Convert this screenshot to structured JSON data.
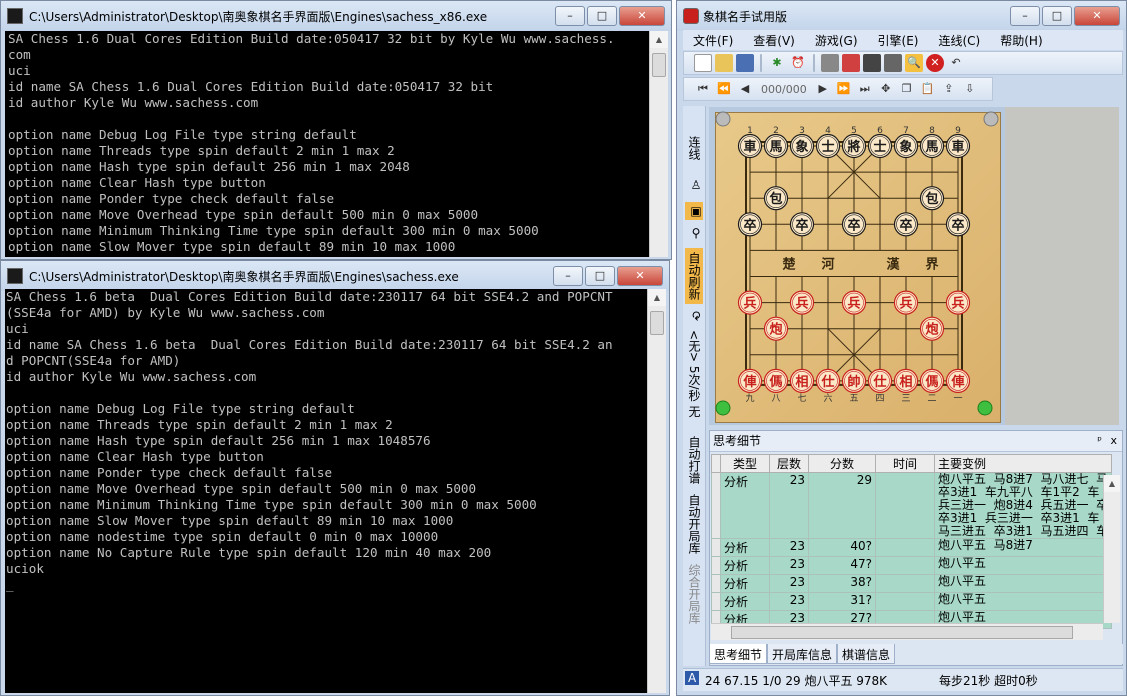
{
  "console1": {
    "title": "C:\\Users\\Administrator\\Desktop\\南奥象棋名手界面版\\Engines\\sachess_x86.exe",
    "lines": [
      "SA Chess 1.6 Dual Cores Edition Build date:050417 32 bit by Kyle Wu www.sachess.",
      "com",
      "uci",
      "id name SA Chess 1.6 Dual Cores Edition Build date:050417 32 bit",
      "id author Kyle Wu www.sachess.com",
      "",
      "option name Debug Log File type string default",
      "option name Threads type spin default 2 min 1 max 2",
      "option name Hash type spin default 256 min 1 max 2048",
      "option name Clear Hash type button",
      "option name Ponder type check default false",
      "option name Move Overhead type spin default 500 min 0 max 5000",
      "option name Minimum Thinking Time type spin default 300 min 0 max 5000",
      "option name Slow Mover type spin default 89 min 10 max 1000"
    ]
  },
  "console2": {
    "title": "C:\\Users\\Administrator\\Desktop\\南奥象棋名手界面版\\Engines\\sachess.exe",
    "lines": [
      "SA Chess 1.6 beta  Dual Cores Edition Build date:230117 64 bit SSE4.2 and POPCNT",
      "(SSE4a for AMD) by Kyle Wu www.sachess.com",
      "uci",
      "id name SA Chess 1.6 beta  Dual Cores Edition Build date:230117 64 bit SSE4.2 an",
      "d POPCNT(SSE4a for AMD)",
      "id author Kyle Wu www.sachess.com",
      "",
      "option name Debug Log File type string default",
      "option name Threads type spin default 2 min 1 max 2",
      "option name Hash type spin default 256 min 1 max 1048576",
      "option name Clear Hash type button",
      "option name Ponder type check default false",
      "option name Move Overhead type spin default 500 min 0 max 5000",
      "option name Minimum Thinking Time type spin default 300 min 0 max 5000",
      "option name Slow Mover type spin default 89 min 10 max 1000",
      "option name nodestime type spin default 0 min 0 max 10000",
      "option name No Capture Rule type spin default 120 min 40 max 200",
      "uciok",
      "_"
    ]
  },
  "app": {
    "title": "象棋名手试用版",
    "menu": [
      "文件(F)",
      "查看(V)",
      "游戏(G)",
      "引擎(E)",
      "连线(C)",
      "帮助(H)"
    ],
    "move_counter": "000/000",
    "sidebar_tabs": [
      "连线",
      "自动刷新",
      "<无> 5次/秒 无",
      "自动打谱",
      "自动开局库",
      "综合开局库"
    ],
    "board": {
      "top_numbers": [
        "1",
        "2",
        "3",
        "4",
        "5",
        "6",
        "7",
        "8",
        "9"
      ],
      "bottom_numbers": [
        "九",
        "八",
        "七",
        "六",
        "五",
        "四",
        "三",
        "二",
        "一"
      ],
      "river": [
        "楚",
        "河",
        "漢",
        "界"
      ],
      "black_pieces": [
        "車",
        "馬",
        "象",
        "士",
        "將",
        "士",
        "象",
        "馬",
        "車",
        "包",
        "包",
        "卒",
        "卒",
        "卒",
        "卒",
        "卒"
      ],
      "red_pieces": [
        "兵",
        "兵",
        "兵",
        "兵",
        "兵",
        "炮",
        "炮",
        "俥",
        "傌",
        "相",
        "仕",
        "帥",
        "仕",
        "相",
        "傌",
        "俥"
      ]
    },
    "panel": {
      "title": "思考细节",
      "pin": "ᵖ",
      "close": "x",
      "headers": [
        "类型",
        "层数",
        "分数",
        "时间",
        "主要变例"
      ],
      "rows": [
        {
          "type": "分析",
          "depth": "23",
          "score": "29",
          "time": "",
          "pv": "炮八平五  马8进7  马八进七  马\n卒3进1  车九平八  车1平2  车\n兵三进一  炮8进4  兵五进一  卒\n卒3进1  兵三进一  卒3进1  车\n马三进五  卒3进1  马五进四  车"
        },
        {
          "type": "分析",
          "depth": "23",
          "score": "40?",
          "time": "",
          "pv": "炮八平五  马8进7"
        },
        {
          "type": "分析",
          "depth": "23",
          "score": "47?",
          "time": "",
          "pv": "炮八平五"
        },
        {
          "type": "分析",
          "depth": "23",
          "score": "38?",
          "time": "",
          "pv": "炮八平五"
        },
        {
          "type": "分析",
          "depth": "23",
          "score": "31?",
          "time": "",
          "pv": "炮八平五"
        },
        {
          "type": "分析",
          "depth": "23",
          "score": "27?",
          "time": "",
          "pv": "炮八平五"
        }
      ]
    },
    "bottom_tabs": [
      "思考细节",
      "开局库信息",
      "棋谱信息"
    ],
    "status": {
      "mode": "A",
      "info": "24  67.15  1/0  29  炮八平五  978K",
      "time": "每步21秒  超时0秒"
    }
  },
  "colors": {
    "console_bg": "#000000",
    "console_fg": "#c0c0c0",
    "black_piece": "#1a1a1a",
    "red_piece": "#c8201c",
    "table_row": "#a7d8c8"
  }
}
